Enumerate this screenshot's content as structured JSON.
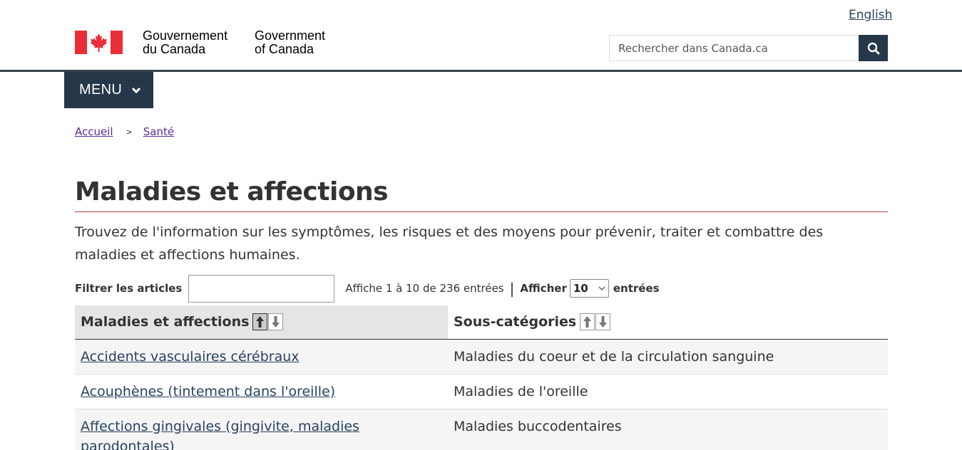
{
  "header": {
    "language_toggle": "English",
    "signature_fr_line1": "Gouvernement",
    "signature_fr_line2": "du Canada",
    "signature_en_line1": "Government",
    "signature_en_line2": "of Canada",
    "search_placeholder": "Rechercher dans Canada.ca",
    "menu_label": "MENU",
    "flag_color": "#eb2d37",
    "brand_dark": "#26374a"
  },
  "breadcrumb": [
    {
      "label": "Accueil"
    },
    {
      "label": "Santé"
    }
  ],
  "page": {
    "title": "Maladies et affections",
    "intro": "Trouvez de l'information sur les symptômes, les risques et des moyens pour prévenir, traiter et combattre des maladies et affections humaines."
  },
  "table_controls": {
    "filter_label": "Filtrer les articles",
    "info_text": "Affiche 1 à 10 de 236 entrées",
    "show_label": "Afficher",
    "page_size": "10",
    "entries_label": "entrées"
  },
  "table": {
    "columns": [
      "Maladies et affections",
      "Sous-catégories"
    ],
    "rows": [
      {
        "name": "Accidents vasculaires cérébraux",
        "category": "Maladies du coeur et de la circulation sanguine"
      },
      {
        "name": "Acouphènes (tintement dans l'oreille)",
        "category": "Maladies de l'oreille"
      },
      {
        "name": "Affections gingivales (gingivite, maladies parodontales)",
        "category": "Maladies buccodentaires"
      }
    ]
  }
}
